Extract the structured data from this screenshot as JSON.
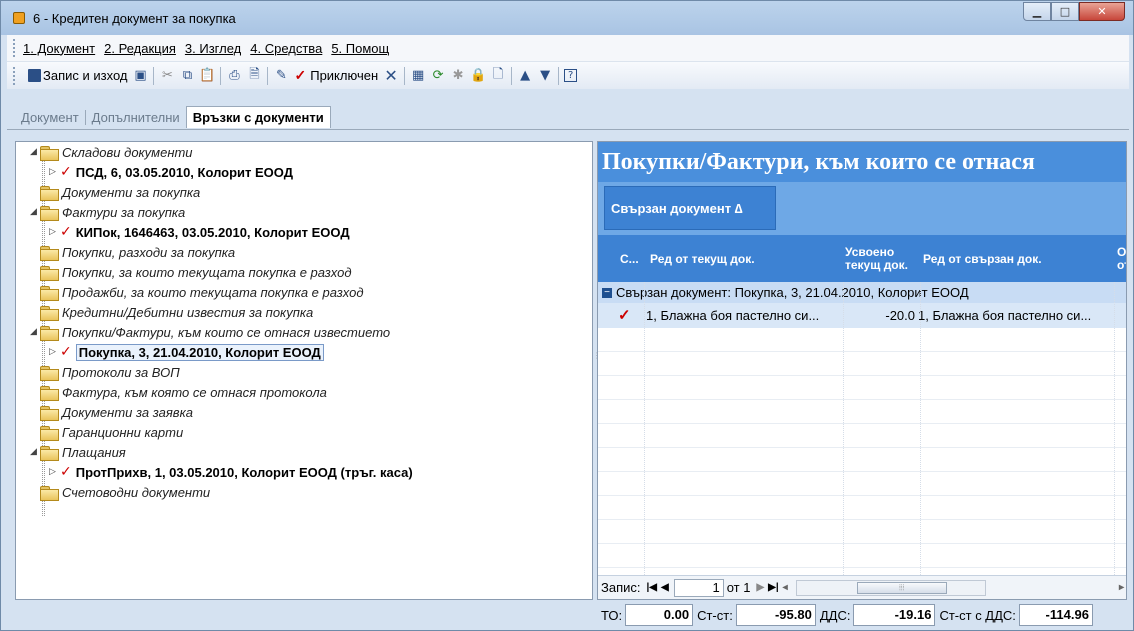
{
  "window": {
    "title": "6 - Кредитен документ за покупка"
  },
  "menu": [
    {
      "num": "1",
      "label": ". Документ"
    },
    {
      "num": "2",
      "label": ". Редакция"
    },
    {
      "num": "3",
      "label": ". Изглед"
    },
    {
      "num": "4",
      "label": ". Средства"
    },
    {
      "num": "5",
      "label": ". Помощ"
    }
  ],
  "toolbar": {
    "save_exit_label": "Запис и изход",
    "completed_label": "Приключен"
  },
  "tabs": [
    {
      "label": "Документ"
    },
    {
      "label": "Допълнителни"
    },
    {
      "label": "Връзки с документи"
    }
  ],
  "tree": [
    {
      "label": "Складови документи",
      "type": "folder",
      "level": 0,
      "expanded": true
    },
    {
      "label": "ПСД, 6, 03.05.2010, Колорит ЕООД",
      "type": "doc",
      "level": 1
    },
    {
      "label": "Документи за покупка",
      "type": "folder",
      "level": 0
    },
    {
      "label": "Фактури за покупка",
      "type": "folder",
      "level": 0,
      "expanded": true
    },
    {
      "label": "КИПок, 1646463, 03.05.2010, Колорит ЕООД",
      "type": "doc",
      "level": 1
    },
    {
      "label": "Покупки, разходи за покупка",
      "type": "folder",
      "level": 0
    },
    {
      "label": "Покупки, за които текущата покупка е разход",
      "type": "folder",
      "level": 0
    },
    {
      "label": "Продажби, за които текущата покупка е разход",
      "type": "folder",
      "level": 0
    },
    {
      "label": "Кредитни/Дебитни известия за покупка",
      "type": "folder",
      "level": 0
    },
    {
      "label": "Покупки/Фактури, към които се отнася известието",
      "type": "folder",
      "level": 0,
      "expanded": true
    },
    {
      "label": "Покупка, 3, 21.04.2010, Колорит ЕООД",
      "type": "doc",
      "level": 1,
      "selected": true
    },
    {
      "label": "Протоколи за ВОП",
      "type": "folder",
      "level": 0
    },
    {
      "label": "Фактура, към която се отнася протокола",
      "type": "folder",
      "level": 0
    },
    {
      "label": "Документи за заявка",
      "type": "folder",
      "level": 0
    },
    {
      "label": "Гаранционни карти",
      "type": "folder",
      "level": 0
    },
    {
      "label": "Плащания",
      "type": "folder",
      "level": 0,
      "expanded": true
    },
    {
      "label": "ПротПрихв, 1, 03.05.2010, Колорит ЕООД (тръг. каса)",
      "type": "doc",
      "level": 1
    },
    {
      "label": "Счетоводни документи",
      "type": "folder",
      "level": 0
    }
  ],
  "right": {
    "title": "Покупки/Фактури, към които се отнася",
    "group_button": "Свързан документ ∆",
    "columns": [
      {
        "label": "С..."
      },
      {
        "label": "Ред от текущ док."
      },
      {
        "label": "Усвоено текущ док."
      },
      {
        "label": "Ред от свързан док."
      },
      {
        "label": "О от"
      }
    ],
    "group_row": "Свързан документ: Покупка, 3, 21.04.2010, Колорит ЕООД",
    "rows": [
      {
        "current_row": "1, Блажна боя пастелно си...",
        "used": "-20.0",
        "linked_row": "1, Блажна боя пастелно си..."
      }
    ],
    "nav": {
      "records_label": "Запис:",
      "current": "1",
      "of_label": "от 1"
    }
  },
  "footer": {
    "to_label": "ТО:",
    "to_value": "0.00",
    "st_label": "Ст-ст:",
    "st_value": "-95.80",
    "vat_label": "ДДС:",
    "vat_value": "-19.16",
    "st_vat_label": "Ст-ст с ДДС:",
    "st_vat_value": "-114.96"
  },
  "colors": {
    "accent": "#3d82d3",
    "title_band": "#4a8fdc",
    "check": "#cc0000"
  }
}
